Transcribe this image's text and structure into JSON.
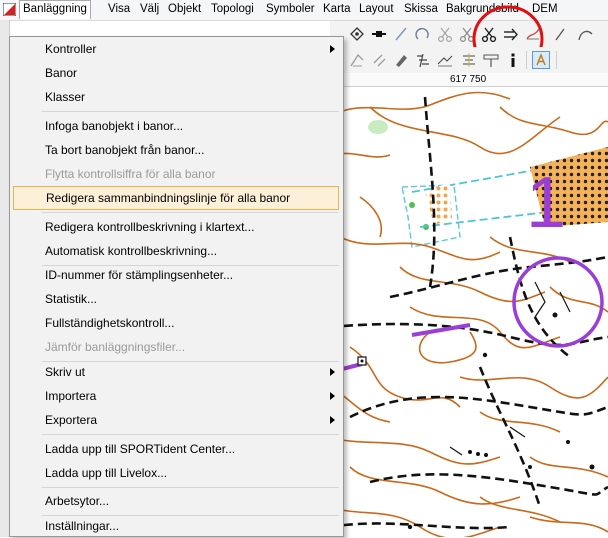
{
  "menubar": {
    "items": [
      "Banläggning",
      "Visa",
      "Välj",
      "Objekt",
      "Topologi",
      "Symboler",
      "Karta",
      "Layout",
      "Skissa",
      "Bakgrundsbild",
      "DEM"
    ]
  },
  "ruler": {
    "coordinate": "617 750"
  },
  "dropdown": {
    "items": [
      {
        "label": "Kontroller",
        "submenu": true
      },
      {
        "label": "Banor"
      },
      {
        "label": "Klasser"
      },
      {
        "label": "Infoga banobjekt i banor..."
      },
      {
        "label": "Ta bort banobjekt från banor..."
      },
      {
        "label": "Flytta kontrollsiffra för alla banor",
        "disabled": true
      },
      {
        "label": "Redigera sammanbindningslinje för alla banor",
        "highlighted": true
      },
      {
        "label": "Redigera kontrollbeskrivning i klartext..."
      },
      {
        "label": "Automatisk kontrollbeskrivning..."
      },
      {
        "label": "ID-nummer för stämplingsenheter..."
      },
      {
        "label": "Statistik..."
      },
      {
        "label": "Fullständighetskontroll..."
      },
      {
        "label": "Jämför banläggningsfiler...",
        "disabled": true
      },
      {
        "label": "Skriv ut",
        "submenu": true
      },
      {
        "label": "Importera",
        "submenu": true
      },
      {
        "label": "Exportera",
        "submenu": true
      },
      {
        "label": "Ladda upp till SPORTident Center..."
      },
      {
        "label": "Ladda upp till Livelox..."
      },
      {
        "label": "Arbetsytor..."
      },
      {
        "label": "Inställningar..."
      }
    ]
  },
  "map": {
    "control_number": "1"
  },
  "colors": {
    "accent_red": "#e01010",
    "course_purple": "#9b3fd4",
    "menu_highlight": "#fdf0d8",
    "contour_brown": "#c8691b"
  }
}
